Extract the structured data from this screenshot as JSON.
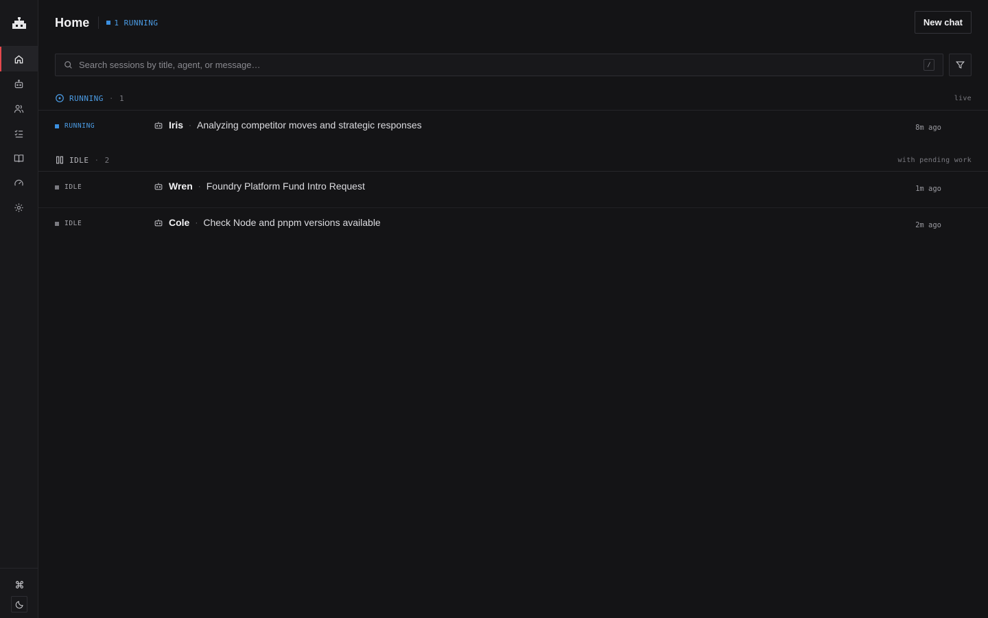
{
  "header": {
    "title": "Home",
    "running_badge": "1 RUNNING",
    "new_chat_label": "New chat"
  },
  "search": {
    "placeholder": "Search sessions by title, agent, or message…",
    "value": "",
    "shortcut": "/"
  },
  "sidebar": {
    "items": [
      {
        "name": "home",
        "icon": "home-icon",
        "active": true
      },
      {
        "name": "agents",
        "icon": "robot-icon",
        "active": false
      },
      {
        "name": "people",
        "icon": "users-icon",
        "active": false
      },
      {
        "name": "tasks",
        "icon": "checklist-icon",
        "active": false
      },
      {
        "name": "library",
        "icon": "book-icon",
        "active": false
      },
      {
        "name": "usage",
        "icon": "gauge-icon",
        "active": false
      },
      {
        "name": "settings",
        "icon": "gear-icon",
        "active": false
      }
    ],
    "bottom": [
      {
        "name": "command",
        "icon": "command-icon"
      },
      {
        "name": "theme",
        "icon": "moon-icon"
      }
    ]
  },
  "sections": {
    "running": {
      "label": "RUNNING",
      "count": "1",
      "right": "live",
      "sessions": [
        {
          "status": "RUNNING",
          "agent": "Iris",
          "title": "Analyzing competitor moves and strategic responses",
          "time": "8m ago"
        }
      ]
    },
    "idle": {
      "label": "IDLE",
      "count": "2",
      "right": "with pending work",
      "sessions": [
        {
          "status": "IDLE",
          "agent": "Wren",
          "title": "Foundry Platform Fund Intro Request",
          "time": "1m ago"
        },
        {
          "status": "IDLE",
          "agent": "Cole",
          "title": "Check Node and pnpm versions available",
          "time": "2m ago"
        }
      ]
    }
  },
  "colors": {
    "accent_running": "#3b8fe0",
    "active_indicator": "#e5484d",
    "background": "#141416"
  }
}
